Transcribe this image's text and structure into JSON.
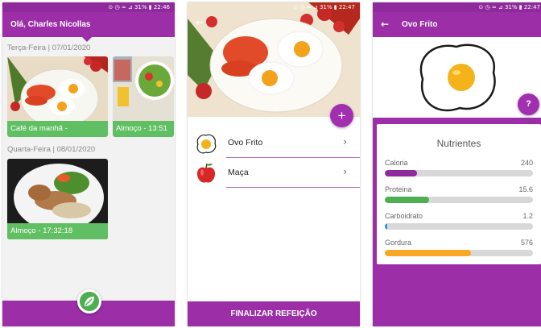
{
  "screen1": {
    "status": "⊙ ◷ ≈ ⊿ 31% ▮ 22:46",
    "title": "Olá, Charles Nicollas",
    "days": [
      {
        "label": "Terça-Feira | 07/01/2020",
        "meals": [
          {
            "caption": "Café da manhã -"
          },
          {
            "caption": "Almoço - 13:51"
          }
        ]
      },
      {
        "label": "Quarta-Feira | 08/01/2020",
        "meals": [
          {
            "caption": "Almoço - 17:32:18"
          }
        ]
      }
    ]
  },
  "screen2": {
    "status": "⊙ ◷ ≈ ⊿ 31% ▮ 22:47",
    "back_icon": "←",
    "add_icon": "+",
    "items": [
      {
        "name": "Ovo Frito",
        "icon": "fried-egg-icon"
      },
      {
        "name": "Maça",
        "icon": "apple-icon"
      }
    ],
    "chevron": "›",
    "finalize_label": "FINALIZAR REFEIÇÃO"
  },
  "screen3": {
    "status": "⊙ ◷ ≈ ⊿ 31% ▮ 22:47",
    "back_icon": "←",
    "title": "Ovo Frito",
    "help_icon": "?",
    "card_title": "Nutrientes",
    "nutrients": [
      {
        "name": "Caloria",
        "value": "240",
        "level": 0.22,
        "color": "#8e2a9b"
      },
      {
        "name": "Proteina",
        "value": "15.6",
        "level": 0.3,
        "color": "#4caf50"
      },
      {
        "name": "Carboidrato",
        "value": "1.2",
        "level": 0.01,
        "color": "#2196f3"
      },
      {
        "name": "Gordura",
        "value": "576",
        "level": 0.58,
        "color": "#f9a825"
      }
    ]
  },
  "colors": {
    "primary": "#9c2fa8",
    "accent_green": "#5fbf62"
  }
}
